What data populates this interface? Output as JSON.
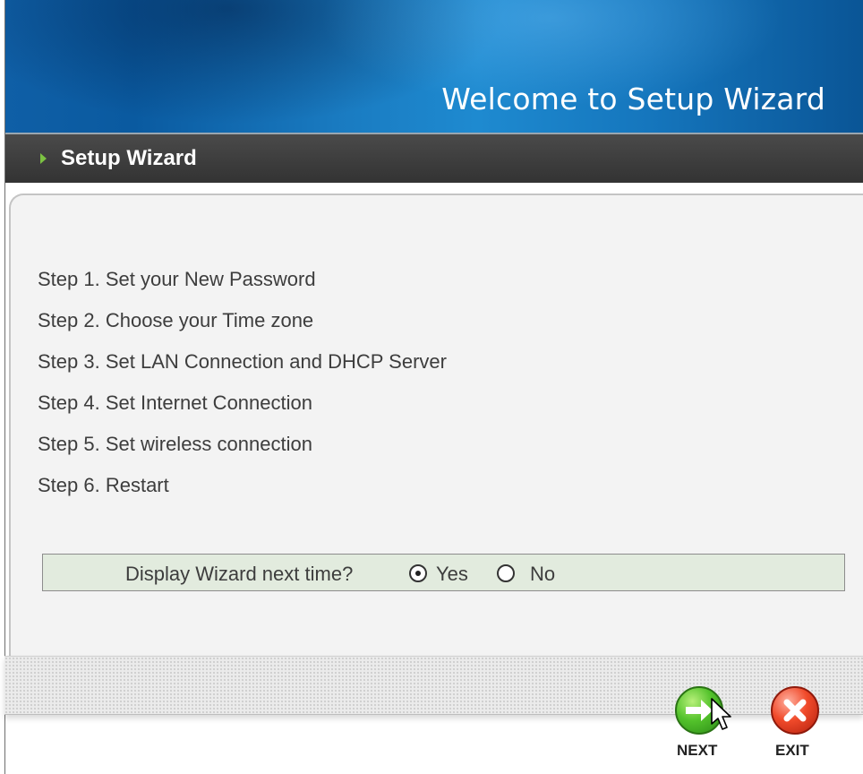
{
  "header": {
    "title": "Welcome to Setup Wizard"
  },
  "subheader": {
    "title": "Setup Wizard"
  },
  "steps": [
    "Step 1. Set your New Password",
    "Step 2. Choose your Time zone",
    "Step 3. Set LAN Connection and DHCP Server",
    "Step 4. Set Internet Connection",
    "Step 5. Set wireless connection",
    "Step 6. Restart"
  ],
  "wizard_option": {
    "question": "Display Wizard next time?",
    "yes_label": "Yes",
    "no_label": "No",
    "selected": "Yes"
  },
  "buttons": {
    "next_label": "NEXT",
    "exit_label": "EXIT"
  },
  "colors": {
    "banner": "#1576bd",
    "subbar": "#3c3c3c",
    "accent_arrow": "#7cc242",
    "next": "#53c22b",
    "exit": "#f04a2a"
  },
  "icons": {
    "next": "arrow-right-icon",
    "exit": "x-icon"
  }
}
